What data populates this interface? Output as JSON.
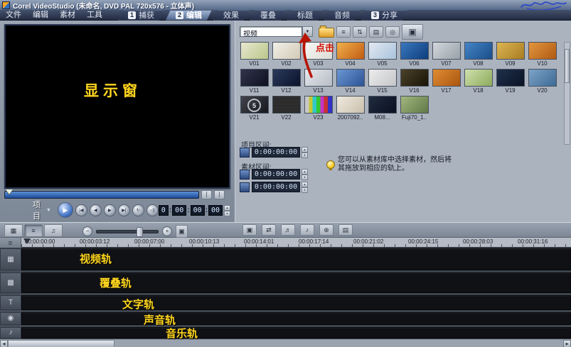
{
  "window": {
    "title": "Corel VideoStudio (未命名, DVD PAL 720x576 - 立体声)"
  },
  "menu": {
    "items": [
      {
        "name": "menu-file",
        "label": "文件"
      },
      {
        "name": "menu-edit",
        "label": "编辑"
      },
      {
        "name": "menu-clip",
        "label": "素材"
      },
      {
        "name": "menu-tools",
        "label": "工具"
      }
    ]
  },
  "steps": [
    {
      "name": "tab-capture",
      "num": "1",
      "label": "捕获",
      "active": false
    },
    {
      "name": "tab-edit",
      "num": "2",
      "label": "编辑",
      "active": true
    },
    {
      "name": "tab-effect",
      "num": "",
      "label": "效果",
      "active": false
    },
    {
      "name": "tab-overlay",
      "num": "",
      "label": "覆叠",
      "active": false
    },
    {
      "name": "tab-title",
      "num": "",
      "label": "标题",
      "active": false
    },
    {
      "name": "tab-audio",
      "num": "",
      "label": "音频",
      "active": false
    },
    {
      "name": "tab-share",
      "num": "3",
      "label": "分享",
      "active": false
    }
  ],
  "preview": {
    "mode_label": "项目",
    "timecode": [
      "0",
      "00",
      "00",
      "00"
    ],
    "transport": [
      {
        "name": "play-button",
        "glyph": "▶",
        "big": true
      },
      {
        "name": "home-button",
        "glyph": "|◀"
      },
      {
        "name": "prev-frame-button",
        "glyph": "◀"
      },
      {
        "name": "next-frame-button",
        "glyph": "▶"
      },
      {
        "name": "end-button",
        "glyph": "▶|"
      },
      {
        "name": "repeat-button",
        "glyph": "↻"
      },
      {
        "name": "volume-button",
        "glyph": "◁)"
      }
    ],
    "trim_buttons": [
      {
        "name": "mark-in-button",
        "glyph": "["
      },
      {
        "name": "mark-out-button",
        "glyph": "]"
      }
    ]
  },
  "library": {
    "gallery_selected": "视频",
    "toolbar_icons": [
      {
        "name": "load-media-folder-icon",
        "glyph": "",
        "folder": true
      },
      {
        "name": "media-options-icon",
        "glyph": "≡"
      },
      {
        "name": "sort-icon",
        "glyph": "⇅"
      },
      {
        "name": "view-mode-icon",
        "glyph": "▤"
      },
      {
        "name": "network-icon",
        "glyph": "◎"
      },
      {
        "name": "capture-frame-button",
        "glyph": "▣",
        "big": true
      }
    ],
    "project_duration_label": "项目区间:",
    "clip_duration_label": "素材区间:",
    "project_duration": "0:00:00:00",
    "mark_in_time": "0:00:00:00",
    "mark_out_time": "0:00:00:00",
    "hint_line1": "您可以从素材库中选择素材，然后将",
    "hint_line2": "其拖放到相应的轨上。",
    "thumbs": [
      {
        "label": "V01",
        "c1": "#e9e7d0",
        "c2": "#b9c789"
      },
      {
        "label": "V02",
        "c1": "#f1efe7",
        "c2": "#d3cab6"
      },
      {
        "label": "V03",
        "c1": "#f6f6f4",
        "c2": "#dddcd6"
      },
      {
        "label": "V04",
        "c1": "#f0b04a",
        "c2": "#c25c14"
      },
      {
        "label": "V05",
        "c1": "#e2e9f1",
        "c2": "#a9c3dc"
      },
      {
        "label": "V06",
        "c1": "#3b77bd",
        "c2": "#0c3d7c"
      },
      {
        "label": "V07",
        "c1": "#d2d7db",
        "c2": "#98a2aa"
      },
      {
        "label": "V08",
        "c1": "#4384c6",
        "c2": "#1a4d89"
      },
      {
        "label": "V09",
        "c1": "#dcb553",
        "c2": "#a87c22"
      },
      {
        "label": "V10",
        "c1": "#e2953f",
        "c2": "#b05a12"
      },
      {
        "label": "V11",
        "c1": "#31344a",
        "c2": "#0e1020"
      },
      {
        "label": "V12",
        "c1": "#2a3a5c",
        "c2": "#0b132a"
      },
      {
        "label": "V13",
        "c1": "#e5e7eb",
        "c2": "#b7bdc6"
      },
      {
        "label": "V14",
        "c1": "#6a97d4",
        "c2": "#2d5394"
      },
      {
        "label": "V15",
        "c1": "#ececec",
        "c2": "#c4c6c9"
      },
      {
        "label": "V16",
        "c1": "#4a4228",
        "c2": "#1a1408"
      },
      {
        "label": "V17",
        "c1": "#e08c33",
        "c2": "#aa5610"
      },
      {
        "label": "V18",
        "c1": "#cfe0ad",
        "c2": "#8cab5c"
      },
      {
        "label": "V19",
        "c1": "#20304c",
        "c2": "#0a1224"
      },
      {
        "label": "V20",
        "c1": "#7da3c8",
        "c2": "#3c6a94"
      },
      {
        "label": "V21",
        "c1": "#43434d",
        "c2": "#17171e",
        "special": "countdown",
        "overlay_text": "5"
      },
      {
        "label": "V22",
        "special": "noise"
      },
      {
        "label": "V23",
        "special": "testbars"
      },
      {
        "label": "2007092..",
        "c1": "#efe9de",
        "c2": "#c9bfae"
      },
      {
        "label": "M08...",
        "c1": "#202c40",
        "c2": "#0a1020"
      },
      {
        "label": "Fuji70_1..",
        "c1": "#a2b77e",
        "c2": "#5f7845"
      }
    ]
  },
  "annotations": {
    "preview_label": "显示窗",
    "click_label": "点击",
    "track_labels": [
      "视频轨",
      "覆叠轨",
      "文字轨",
      "声音轨",
      "音乐轨"
    ]
  },
  "timeline": {
    "view_buttons": [
      {
        "name": "storyboard-view-button",
        "glyph": "▦",
        "active": false
      },
      {
        "name": "timeline-view-button",
        "glyph": "≡",
        "active": true
      },
      {
        "name": "audio-view-button",
        "glyph": "♫",
        "active": false
      }
    ],
    "tool_icons": [
      {
        "name": "insert-media-icon",
        "glyph": "▣"
      },
      {
        "name": "batch-convert-icon",
        "glyph": "⇄"
      },
      {
        "name": "sound-mixer-icon",
        "glyph": "♬"
      },
      {
        "name": "auto-music-icon",
        "glyph": "♪"
      },
      {
        "name": "chapter-point-icon",
        "glyph": "⊕"
      },
      {
        "name": "track-manager-icon",
        "glyph": "▤"
      }
    ],
    "ruler_labels": [
      "00:00:00:00",
      "00:00:03:12",
      "00:00:07:00",
      "00:00:10:13",
      "00:00:14:01",
      "00:00:17:14",
      "00:00:21:02",
      "00:00:24:15",
      "00:00:28:03",
      "00:00:31:16"
    ],
    "tracks": [
      {
        "name": "video-track",
        "icon_name": "video-track-icon",
        "icon": "▦"
      },
      {
        "name": "overlay-track",
        "icon_name": "overlay-track-icon",
        "icon": "▩"
      },
      {
        "name": "title-track",
        "icon_name": "title-track-icon",
        "icon": "T"
      },
      {
        "name": "voice-track",
        "icon_name": "voice-track-icon",
        "icon": "◉"
      },
      {
        "name": "music-track",
        "icon_name": "music-track-icon",
        "icon": "♪"
      }
    ]
  }
}
